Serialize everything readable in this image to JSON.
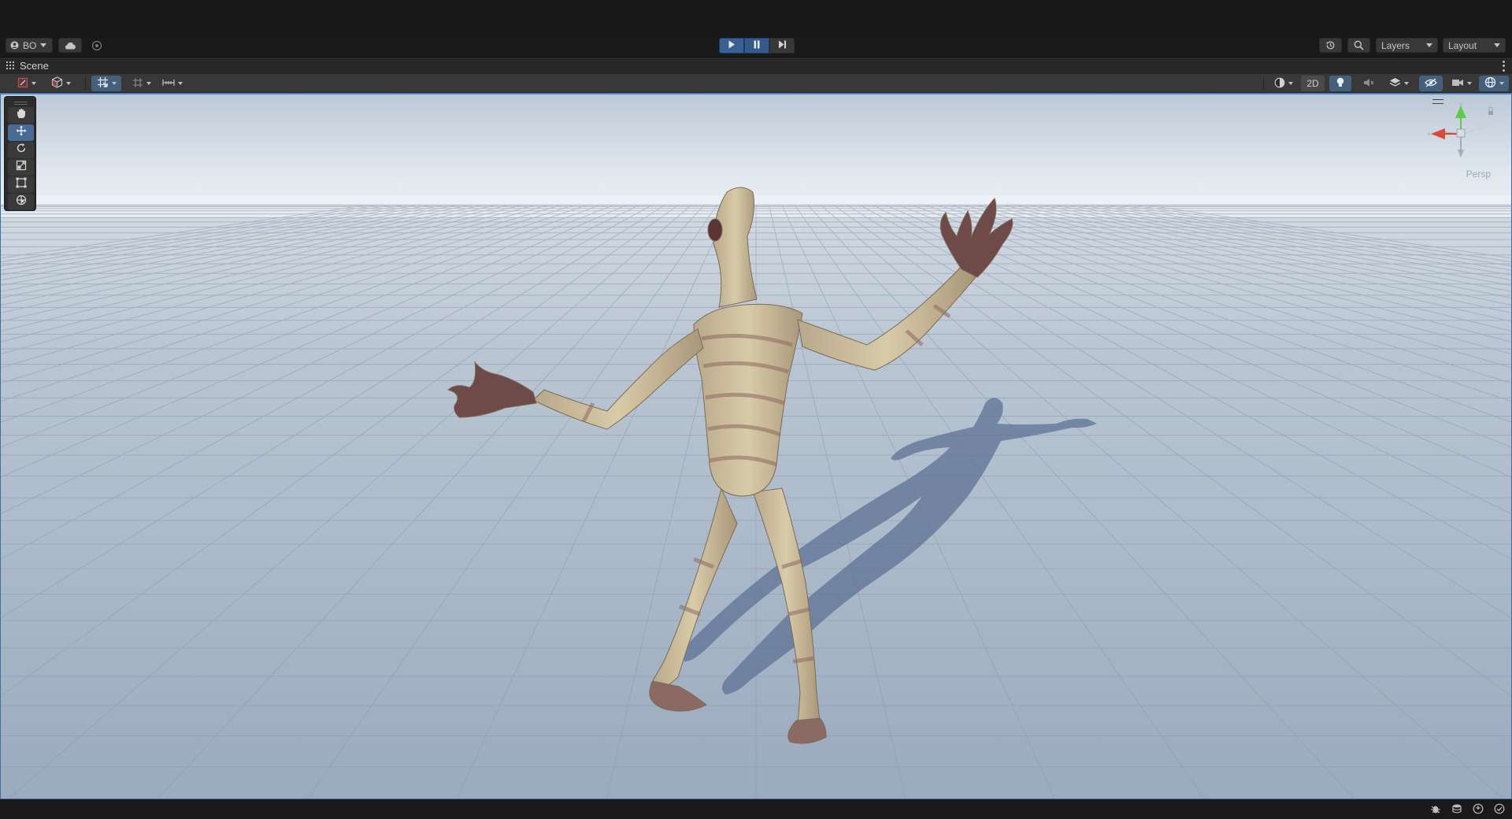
{
  "toolbar": {
    "account_label": "BO",
    "layers_label": "Layers",
    "layout_label": "Layout"
  },
  "scene_tab": {
    "label": "Scene"
  },
  "scene_toolbar": {
    "view_2d_label": "2D"
  },
  "viewport": {
    "projection_label": "Persp",
    "sky_color": "#c9d4df",
    "ground_color": "#9fb0c4",
    "selection_outline_color": "#4f86c6"
  },
  "tools": {
    "items": [
      "hand-tool",
      "move-tool",
      "rotate-tool",
      "scale-tool",
      "rect-tool",
      "transform-tool"
    ],
    "active": "move-tool"
  },
  "colors": {
    "accent_play": "#3a5f92",
    "panel_bg": "#383838",
    "dark_bg": "#191919"
  }
}
